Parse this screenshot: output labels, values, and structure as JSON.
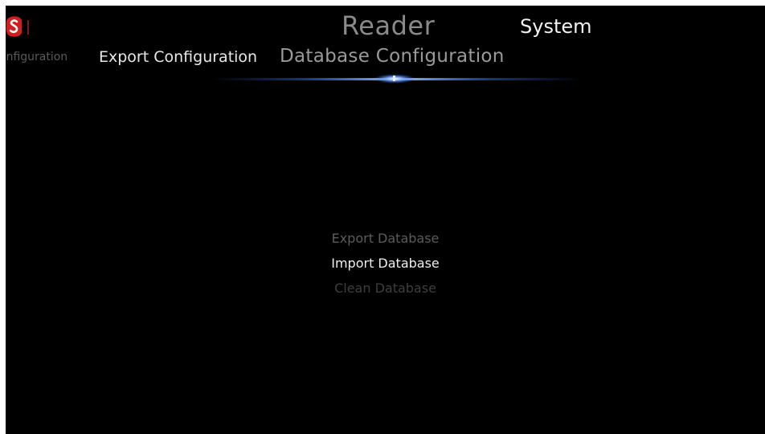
{
  "logo": {
    "icon": "brand-s-logo-icon",
    "color": "#d11f1f"
  },
  "top_nav": {
    "items": [
      {
        "label": "Reader",
        "state": "inactive"
      },
      {
        "label": "System",
        "state": "active"
      }
    ]
  },
  "sub_nav": {
    "items": [
      {
        "label": "onfiguration",
        "state": "offscreen"
      },
      {
        "label": "Export Configuration",
        "state": "neighbor"
      },
      {
        "label": "Database Configuration",
        "state": "selected"
      }
    ]
  },
  "menu": {
    "items": [
      {
        "label": "Export Database",
        "state": "dimmed"
      },
      {
        "label": "Import Database",
        "state": "focused"
      },
      {
        "label": "Clean Database",
        "state": "dimmed"
      }
    ]
  },
  "colors": {
    "background": "#000000",
    "accent_glow": "#4a7dff",
    "active_text": "#f0f0f0",
    "inactive_text": "#8a8a8a"
  }
}
